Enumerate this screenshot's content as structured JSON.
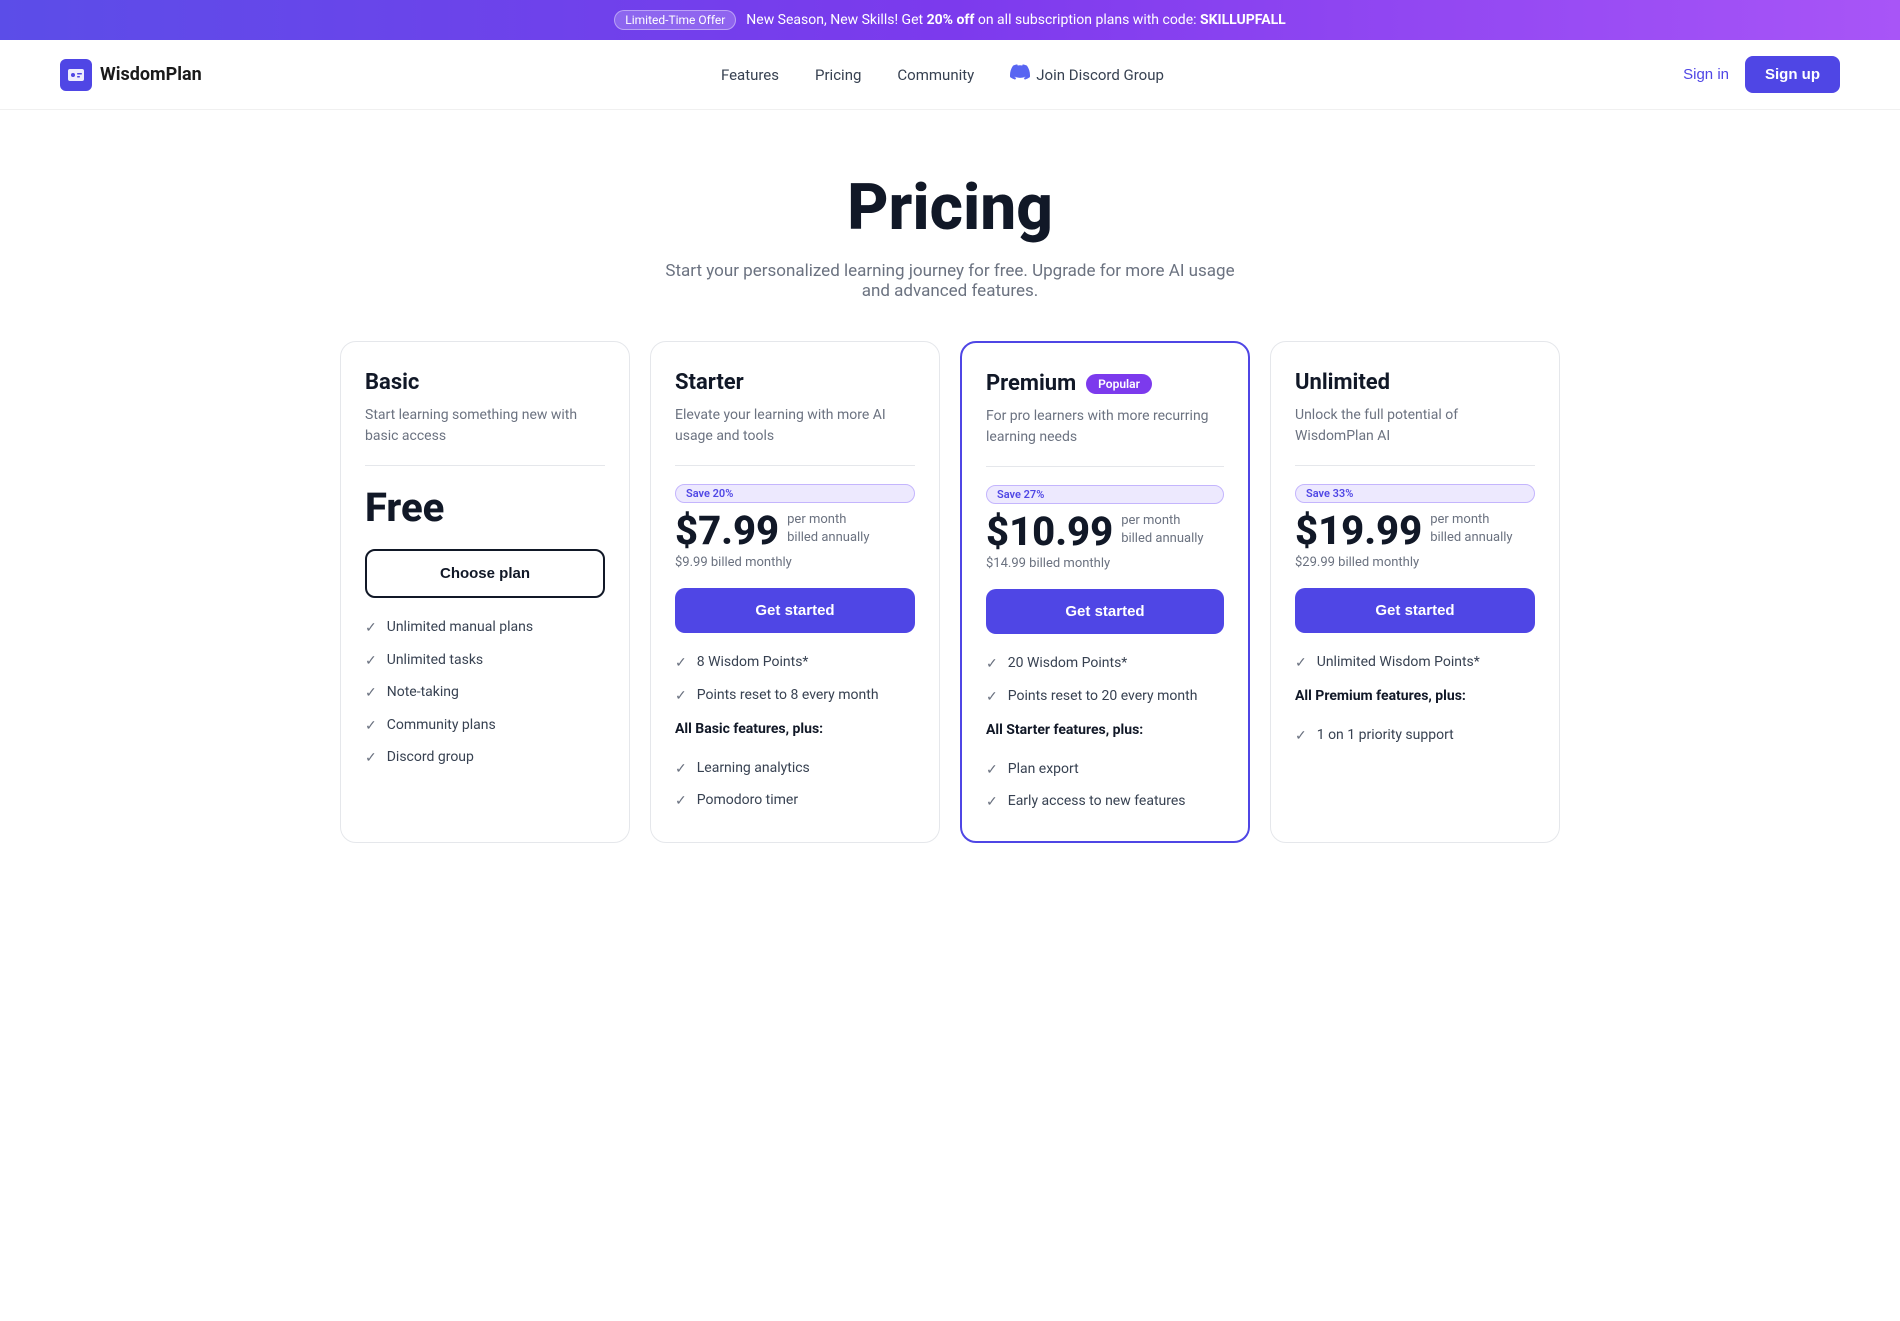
{
  "banner": {
    "badge": "Limited-Time Offer",
    "text_before": "New Season, New Skills! Get ",
    "discount": "20% off",
    "text_after": " on all subscription plans with code: ",
    "code": "SKILLUPFALL"
  },
  "nav": {
    "logo_text": "WisdomPlan",
    "links": [
      {
        "label": "Features",
        "href": "#"
      },
      {
        "label": "Pricing",
        "href": "#"
      },
      {
        "label": "Community",
        "href": "#"
      },
      {
        "label": "Join Discord Group",
        "href": "#",
        "discord": true
      }
    ],
    "signin_label": "Sign in",
    "signup_label": "Sign up"
  },
  "hero": {
    "title": "Pricing",
    "subtitle": "Start your personalized learning journey for free. Upgrade for more AI usage and advanced features."
  },
  "plans": [
    {
      "id": "basic",
      "name": "Basic",
      "description": "Start learning something new with basic access",
      "price_label": "Free",
      "save_badge": null,
      "price_amount": null,
      "price_period": null,
      "price_monthly": null,
      "cta_label": "Choose plan",
      "cta_type": "outline",
      "featured": false,
      "popular": false,
      "features": [
        {
          "text": "Unlimited manual plans",
          "bold": false
        },
        {
          "text": "Unlimited tasks",
          "bold": false
        },
        {
          "text": "Note-taking",
          "bold": false
        },
        {
          "text": "Community plans",
          "bold": false
        },
        {
          "text": "Discord group",
          "bold": false
        }
      ],
      "section_label": null
    },
    {
      "id": "starter",
      "name": "Starter",
      "description": "Elevate your learning with more AI usage and tools",
      "price_label": null,
      "save_badge": "Save 20%",
      "price_amount": "$7.99",
      "price_period": "per month\nbilled annually",
      "price_monthly": "$9.99 billed monthly",
      "cta_label": "Get started",
      "cta_type": "filled",
      "featured": false,
      "popular": false,
      "features": [
        {
          "text": "8 Wisdom Points*",
          "bold": false
        },
        {
          "text": "Points reset to 8 every month",
          "bold": false
        }
      ],
      "section_label": "All Basic features, plus:",
      "extra_features": [
        {
          "text": "Learning analytics",
          "bold": false
        },
        {
          "text": "Pomodoro timer",
          "bold": false
        }
      ]
    },
    {
      "id": "premium",
      "name": "Premium",
      "description": "For pro learners with more recurring learning needs",
      "price_label": null,
      "save_badge": "Save 27%",
      "price_amount": "$10.99",
      "price_period": "per month\nbilled annually",
      "price_monthly": "$14.99 billed monthly",
      "cta_label": "Get started",
      "cta_type": "filled",
      "featured": true,
      "popular": true,
      "features": [
        {
          "text": "20 Wisdom Points*",
          "bold": false
        },
        {
          "text": "Points reset to 20 every month",
          "bold": false
        }
      ],
      "section_label": "All Starter features, plus:",
      "extra_features": [
        {
          "text": "Plan export",
          "bold": false
        },
        {
          "text": "Early access to new features",
          "bold": false
        }
      ]
    },
    {
      "id": "unlimited",
      "name": "Unlimited",
      "description": "Unlock the full potential of WisdomPlan AI",
      "price_label": null,
      "save_badge": "Save 33%",
      "price_amount": "$19.99",
      "price_period": "per month\nbilled annually",
      "price_monthly": "$29.99 billed monthly",
      "cta_label": "Get started",
      "cta_type": "filled",
      "featured": false,
      "popular": false,
      "features": [
        {
          "text": "Unlimited Wisdom Points*",
          "bold": false
        }
      ],
      "section_label": "All Premium features, plus:",
      "extra_features": [
        {
          "text": "1 on 1 priority support",
          "bold": false
        }
      ]
    }
  ]
}
